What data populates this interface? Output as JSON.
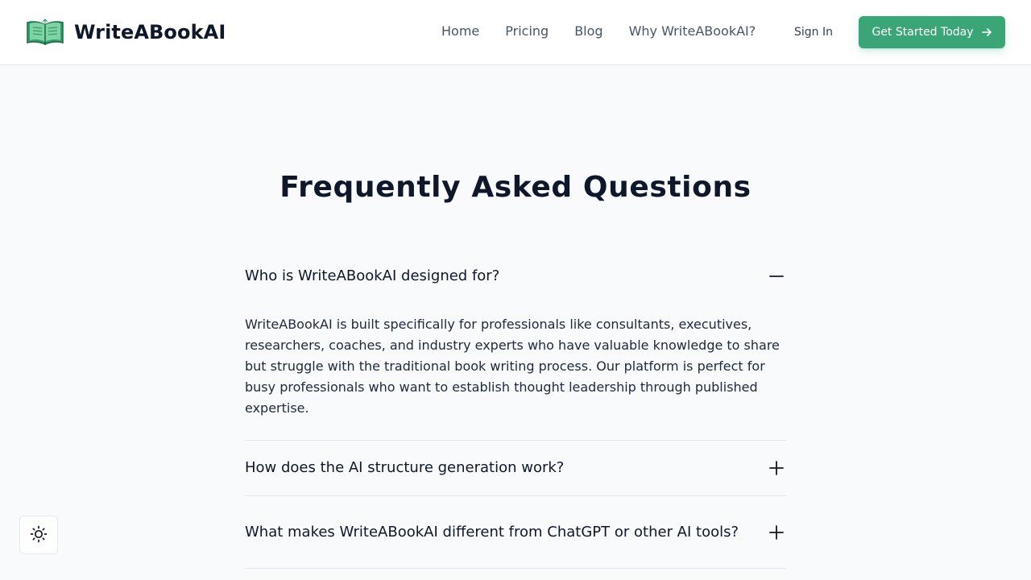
{
  "brand": {
    "name": "WriteABookAI",
    "logo_icon": "open-book-icon"
  },
  "nav": {
    "links": [
      "Home",
      "Pricing",
      "Blog",
      "Why WriteABookAI?"
    ],
    "sign_in": "Sign In",
    "cta": "Get Started Today",
    "cta_icon": "arrow-right-icon"
  },
  "colors": {
    "accent": "#3aa577",
    "heading": "#0f172a",
    "page_background": "#f8fafc"
  },
  "faq": {
    "title": "Frequently Asked Questions",
    "items": [
      {
        "question": "Who is WriteABookAI designed for?",
        "answer": "WriteABookAI is built specifically for professionals like consultants, executives, researchers, coaches, and industry experts who have valuable knowledge to share but struggle with the traditional book writing process. Our platform is perfect for busy professionals who want to establish thought leadership through published expertise.",
        "expanded": true,
        "icon": "minus-icon"
      },
      {
        "question": "How does the AI structure generation work?",
        "expanded": false,
        "icon": "plus-icon"
      },
      {
        "question": "What makes WriteABookAI different from ChatGPT or other AI tools?",
        "expanded": false,
        "icon": "plus-icon"
      }
    ]
  },
  "theme_toggle": {
    "icon": "sun-icon"
  }
}
